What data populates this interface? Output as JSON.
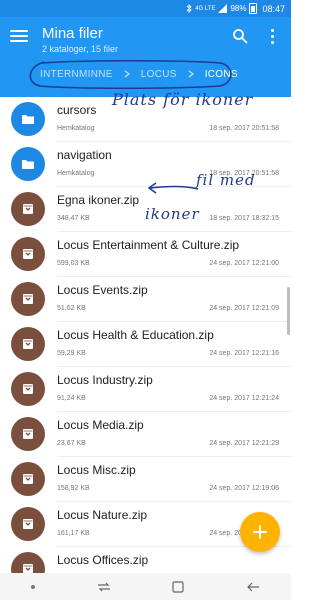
{
  "statusbar": {
    "network": "4G LTE",
    "battery": "98%",
    "time": "08:47"
  },
  "appbar": {
    "title": "Mina filer",
    "subtitle": "2 kataloger, 15 filer",
    "breadcrumb": [
      "INTERNMINNE",
      "LOCUS",
      "ICONS"
    ]
  },
  "annotations": {
    "note1": "Plats för ikoner",
    "note2a": "fil med",
    "note2b": "ikoner"
  },
  "files": [
    {
      "name": "cursors",
      "meta": "Hemkatalog",
      "date": "18 sep. 2017 20:51:58",
      "type": "folder"
    },
    {
      "name": "navigation",
      "meta": "Hemkatalog",
      "date": "18 sep. 2017 20:51:58",
      "type": "folder"
    },
    {
      "name": "Egna ikoner.zip",
      "meta": "348,47 KB",
      "date": "18 sep. 2017 18:32:15",
      "type": "zip"
    },
    {
      "name": "Locus Entertainment & Culture.zip",
      "meta": "599,03 KB",
      "date": "24 sep. 2017 12:21:00",
      "type": "zip"
    },
    {
      "name": "Locus Events.zip",
      "meta": "51,62 KB",
      "date": "24 sep. 2017 12:21:09",
      "type": "zip"
    },
    {
      "name": "Locus Health & Education.zip",
      "meta": "59,29 KB",
      "date": "24 sep. 2017 12:21:16",
      "type": "zip"
    },
    {
      "name": "Locus Industry.zip",
      "meta": "91,24 KB",
      "date": "24 sep. 2017 12:21:24",
      "type": "zip"
    },
    {
      "name": "Locus Media.zip",
      "meta": "23,67 KB",
      "date": "24 sep. 2017 12:21:29",
      "type": "zip"
    },
    {
      "name": "Locus Misc.zip",
      "meta": "158,92 KB",
      "date": "24 sep. 2017 12:19:06",
      "type": "zip"
    },
    {
      "name": "Locus Nature.zip",
      "meta": "161,17 KB",
      "date": "24 sep. 2017 12:21:36",
      "type": "zip"
    },
    {
      "name": "Locus Offices.zip",
      "meta": "",
      "date": "",
      "type": "zip"
    }
  ],
  "colors": {
    "appbar": "#2196f3",
    "folder": "#1e88e5",
    "zip": "#7b4f3e",
    "fab": "#ffb300",
    "ink": "#1f3b8f"
  },
  "icons": [
    "menu-icon",
    "search-icon",
    "more-icon",
    "folder-icon",
    "archive-icon",
    "add-icon",
    "chevron-right-icon"
  ]
}
